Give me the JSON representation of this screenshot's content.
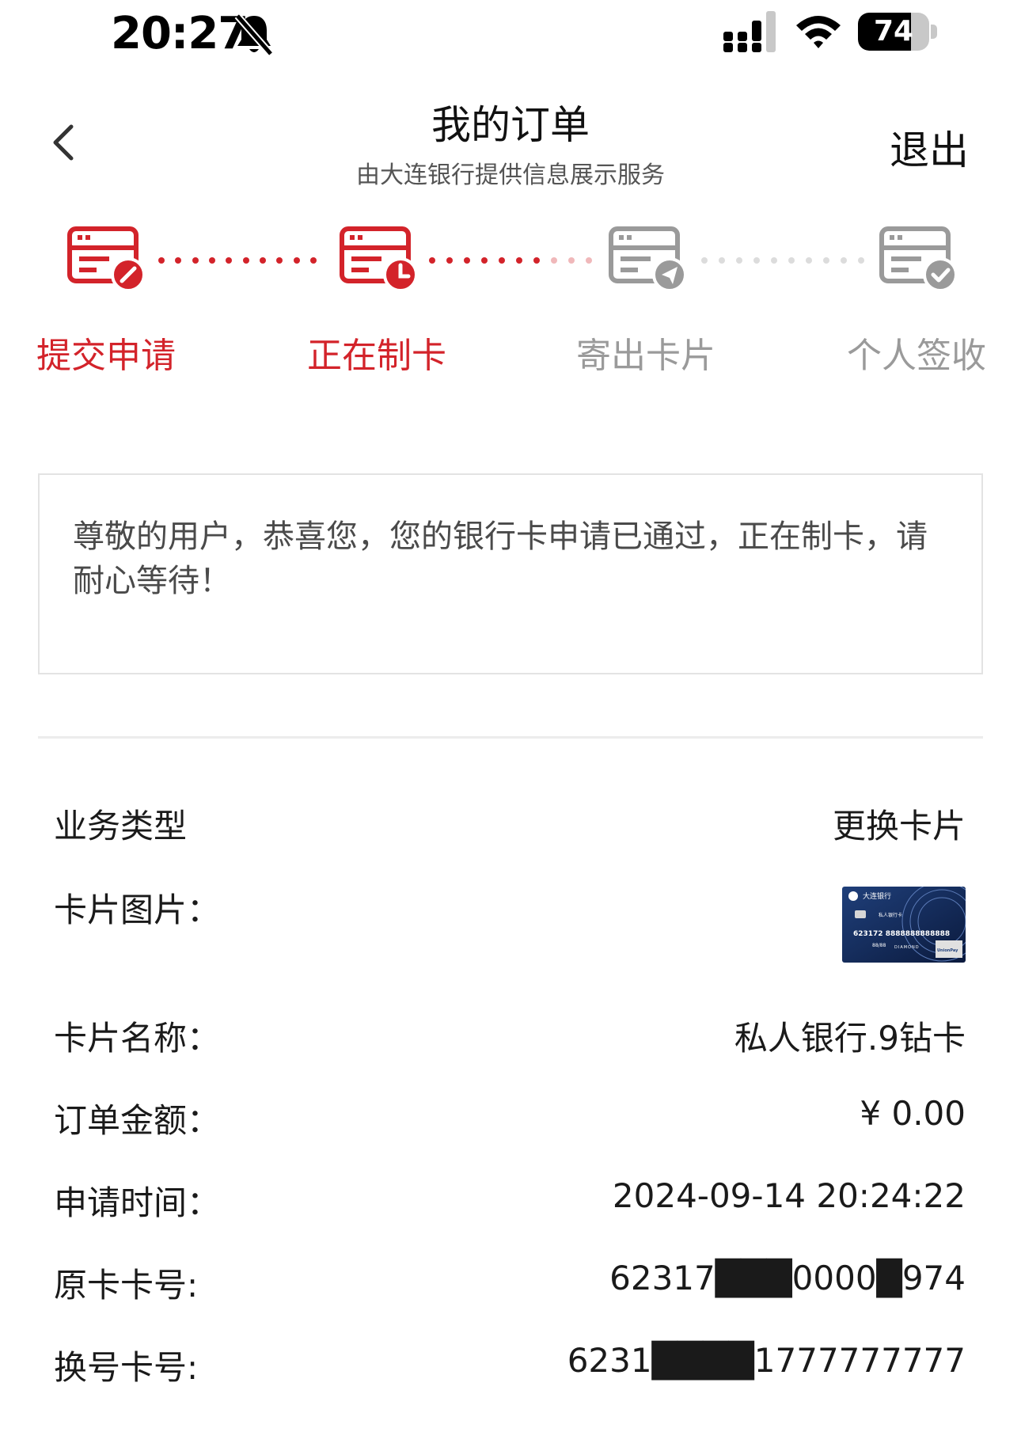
{
  "status_bar": {
    "time": "20:27",
    "battery": 74,
    "battery_label": "74",
    "icons": [
      "bell-slash-icon",
      "signal-icon",
      "wifi-icon",
      "battery-icon"
    ]
  },
  "header": {
    "title": "我的订单",
    "subtitle": "由大连银行提供信息展示服务",
    "exit_label": "退出",
    "back_icon": "chevron-left-icon"
  },
  "steps": [
    {
      "label": "提交申请",
      "state": "done",
      "icon": "edit-card-icon"
    },
    {
      "label": "正在制卡",
      "state": "done",
      "icon": "clock-card-icon"
    },
    {
      "label": "寄出卡片",
      "state": "todo",
      "icon": "send-card-icon"
    },
    {
      "label": "个人签收",
      "state": "todo",
      "icon": "check-card-icon"
    }
  ],
  "message": "尊敬的用户，恭喜您，您的银行卡申请已通过，正在制卡，请耐心等待！",
  "details": {
    "business_type": {
      "label": "业务类型",
      "value": "更换卡片"
    },
    "card_image": {
      "label": "卡片图片：",
      "card_bank": "大连银行",
      "card_tier": "私人银行卡",
      "card_number": "623172 8888888888888",
      "card_expiry": "88/88",
      "card_series": "DIAMOND",
      "card_network": "UnionPay"
    },
    "card_name": {
      "label": "卡片名称：",
      "value": "私人银行.9钻卡"
    },
    "order_amount": {
      "label": "订单金额：",
      "value": "¥ 0.00"
    },
    "apply_time": {
      "label": "申请时间：",
      "value": "2024-09-14 20:24:22"
    },
    "original_card": {
      "label": "原卡卡号:",
      "value": "62317███0000█974"
    },
    "new_card": {
      "label": "换号卡号:",
      "value": "6231████1777777777"
    }
  },
  "colors": {
    "accent": "#d3232a",
    "inactive": "#9a9a9a",
    "border": "#e3e3e3"
  }
}
